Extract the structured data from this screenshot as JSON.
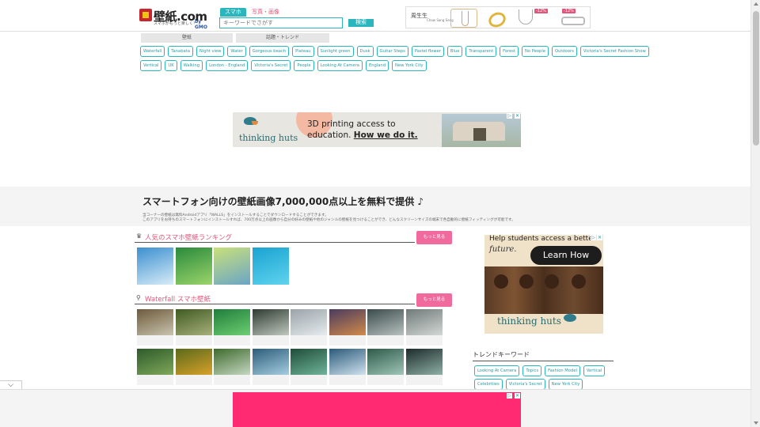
{
  "header": {
    "logo_text": "壁紙.com",
    "logo_tagline": "スマホがもっと楽しく！",
    "logo_sub": "www.kabegami.com",
    "logo_partner": "by GMO",
    "search_tabs": [
      "スマホ",
      "写真・画像"
    ],
    "search_placeholder": "キーワードでさがす",
    "search_button": "検索",
    "ad_text": "周生生",
    "ad_subtext": "Chow Sang Sang",
    "ad_discounts": [
      "-12%",
      "-12%"
    ]
  },
  "category_tabs": [
    "壁紙",
    "話題・トレンド"
  ],
  "keywords": [
    [
      "Waterfall",
      "Tanabata",
      "Night view",
      "Water",
      "Gorgeous beach",
      "Plateau",
      "Sunlight green",
      "Dusk",
      "Guitar Steps",
      "Pastel flower",
      "Blue",
      "Transparent",
      "Forest",
      "No People",
      "Outdoors",
      "Victoria's Secret Fashion Show"
    ],
    [
      "Vertical",
      "UK",
      "Walking",
      "London - England",
      "Victoria's Secret",
      "People",
      "Looking At Camera",
      "England",
      "New York City"
    ]
  ],
  "top_ad": {
    "brand": "thinking huts",
    "line1": "3D printing access to",
    "line2_prefix": "education. ",
    "line2_link": "How we do it.",
    "close": "✕"
  },
  "band": {
    "title": "スマートフォン向けの壁紙画像7,000,000点以上を無料で提供 ♪",
    "desc1": "当コーナーの壁紙は無料Androidアプリ「WALLS」をインストールすることでダウンロードすることができます。",
    "desc2": "このアプリをお持ちのスマートフォンにインストールすれば、700万点以上の画像から自分の好みの壁紙や他のジャンルの壁紙を見つけることができ、どんなスクリーンサイズの端末で色自動的に壁紙フィッティングが可能です。"
  },
  "ranking": {
    "icon": "♛",
    "title": "人気のスマホ壁紙ランキング",
    "more": "もっと見る",
    "thumb_colors": [
      [
        "#3b8fd0",
        "#d8ecf7"
      ],
      [
        "#2a8a3c",
        "#9bd46a"
      ],
      [
        "#c9e07a",
        "#6aa5c6"
      ],
      [
        "#1aa3d1",
        "#5fd3ee"
      ]
    ]
  },
  "waterfall": {
    "icon": "🔍",
    "title": "Waterfall スマホ壁紙",
    "more": "もっと見る",
    "thumb_colors": [
      [
        "#6d5a3a",
        "#c9c4b0"
      ],
      [
        "#3f5a22",
        "#a7b07a"
      ],
      [
        "#1f7d3a",
        "#6dcf72"
      ],
      [
        "#2e3b30",
        "#c0c8c0"
      ],
      [
        "#9aa3a8",
        "#e6ecef"
      ],
      [
        "#4a3b5e",
        "#d28a4a"
      ],
      [
        "#3a4a4a",
        "#b8c2c0"
      ],
      [
        "#6f7a78",
        "#d3d8d6"
      ],
      [
        "#2d5a2a",
        "#7fa85a"
      ],
      [
        "#5a6a1a",
        "#d9a02a"
      ],
      [
        "#3e6a2e",
        "#c5d8c0"
      ],
      [
        "#2c5d7a",
        "#a6cde0"
      ],
      [
        "#1f4d3a",
        "#6fb49a"
      ],
      [
        "#2b5a7a",
        "#cfe2ee"
      ],
      [
        "#2e5a4a",
        "#9fc6b8"
      ],
      [
        "#1c2b2a",
        "#8fb0a6"
      ]
    ]
  },
  "side_ad": {
    "headline": "Help students access a better",
    "headline2": "future.",
    "button": "Learn How",
    "brand": "thinking huts",
    "close": "✕"
  },
  "trend": {
    "title": "トレンドキーワード",
    "keywords": [
      "Looking At Camera",
      "Topics",
      "Fashion Model",
      "Vertical",
      "Celebrities",
      "Victoria's Secret",
      "New York City"
    ]
  },
  "collapse_icon": "⌵",
  "bottom_ad": {
    "close": "✕"
  }
}
